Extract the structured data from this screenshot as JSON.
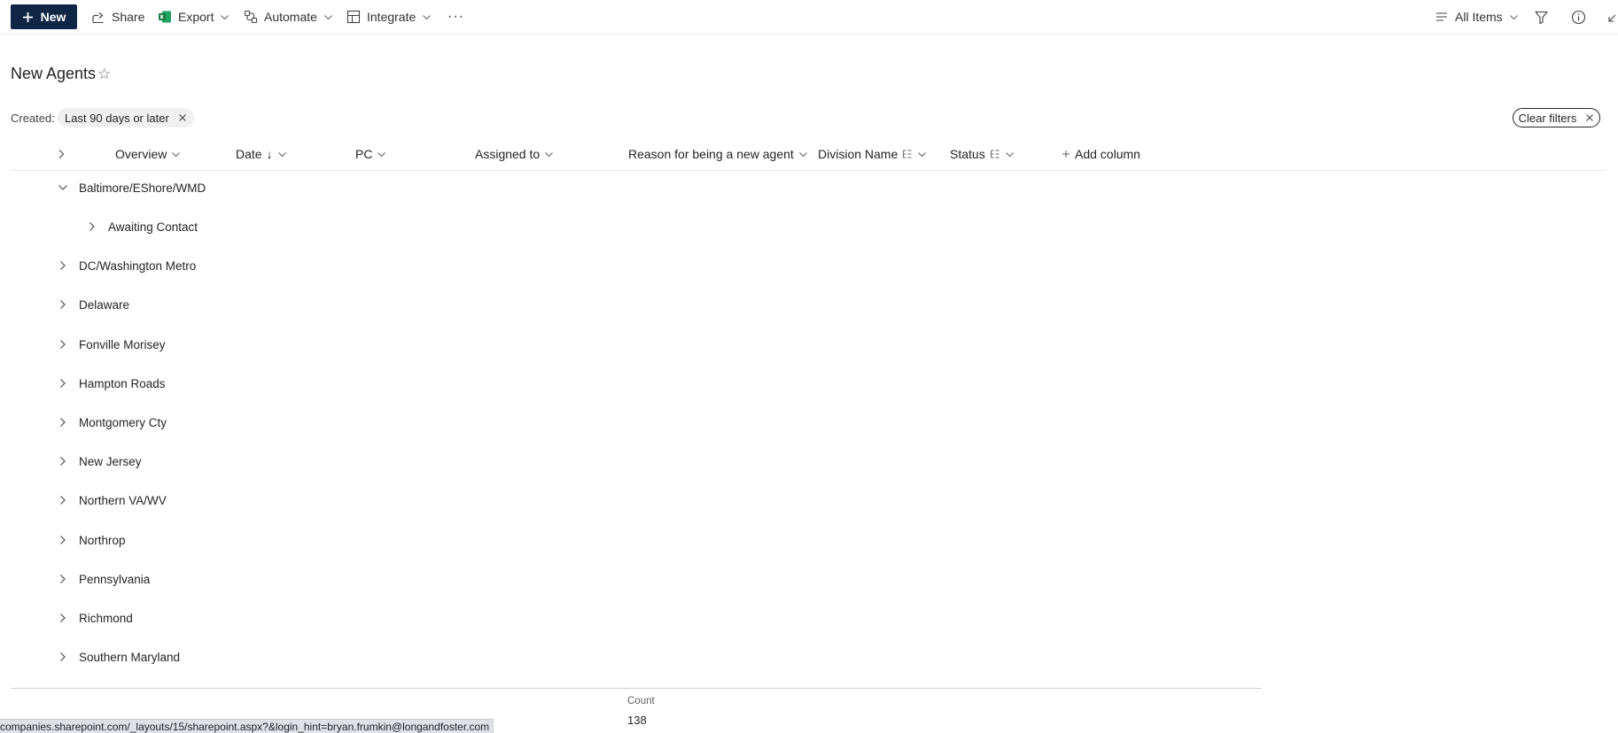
{
  "commandbar": {
    "new_label": "New",
    "share_label": "Share",
    "export_label": "Export",
    "automate_label": "Automate",
    "integrate_label": "Integrate",
    "more_label": "···",
    "view_label": "All Items"
  },
  "page": {
    "title": "New Agents",
    "star": "☆"
  },
  "filters": {
    "created_label": "Created:",
    "active_filter": "Last 90 days or later",
    "clear_label": "Clear filters"
  },
  "columns": [
    {
      "label": "Overview"
    },
    {
      "label": "Date",
      "sort": "↓"
    },
    {
      "label": "PC"
    },
    {
      "label": "Assigned to"
    },
    {
      "label": "Reason for being a new agent"
    },
    {
      "label": "Division Name"
    },
    {
      "label": "Status"
    },
    {
      "label": "Add column"
    }
  ],
  "groups": [
    {
      "label": "Baltimore/EShore/WMD",
      "expanded": true,
      "children": [
        {
          "label": "Awaiting Contact"
        }
      ]
    },
    {
      "label": "DC/Washington Metro"
    },
    {
      "label": "Delaware"
    },
    {
      "label": "Fonville Morisey"
    },
    {
      "label": "Hampton Roads"
    },
    {
      "label": "Montgomery Cty"
    },
    {
      "label": "New Jersey"
    },
    {
      "label": "Northern VA/WV"
    },
    {
      "label": "Northrop"
    },
    {
      "label": "Pennsylvania"
    },
    {
      "label": "Richmond"
    },
    {
      "label": "Southern Maryland"
    }
  ],
  "footer": {
    "count_label": "Count",
    "count_value": "138"
  },
  "status_bar": {
    "url": "companies.sharepoint.com/_layouts/15/sharepoint.aspx?&login_hint=bryan.frumkin@longandfoster.com"
  },
  "colors": {
    "accent": "#0f2745",
    "excel_green": "#107c41"
  }
}
